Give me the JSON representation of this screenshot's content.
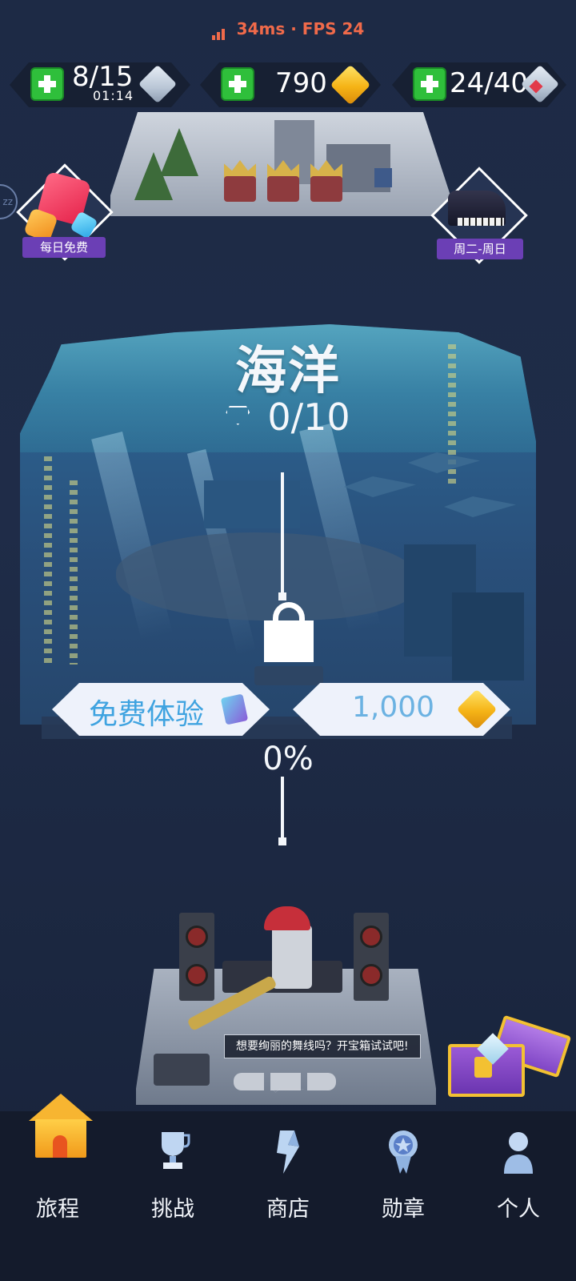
{
  "status": {
    "ping": "34ms",
    "separator": "·",
    "fps": "FPS 24"
  },
  "resources": {
    "energy": {
      "value": "8/15",
      "timer": "01:14",
      "icon": "ice-cube-icon"
    },
    "gold": {
      "value": "790",
      "icon": "gold-gem-icon"
    },
    "hearts": {
      "value": "24/40",
      "icon": "heart-cube-icon"
    }
  },
  "side_badges": {
    "daily_free": "每日免费",
    "weekday": "周二-周日"
  },
  "level": {
    "title": "海洋",
    "diamonds": "0/10",
    "free_trial": "免费体验",
    "price": "1,000",
    "progress": "0%"
  },
  "chest_tip": "想要绚丽的舞线吗？开宝箱试试吧!",
  "nav": {
    "journey": "旅程",
    "challenge": "挑战",
    "shop": "商店",
    "medal": "勋章",
    "profile": "个人"
  },
  "colors": {
    "accent_gold": "#f5b316",
    "plus_green": "#2fbf3b",
    "badge_purple": "#6b3fb5",
    "trial_blue": "#3fa3e0",
    "status_red": "#f06a4a"
  }
}
